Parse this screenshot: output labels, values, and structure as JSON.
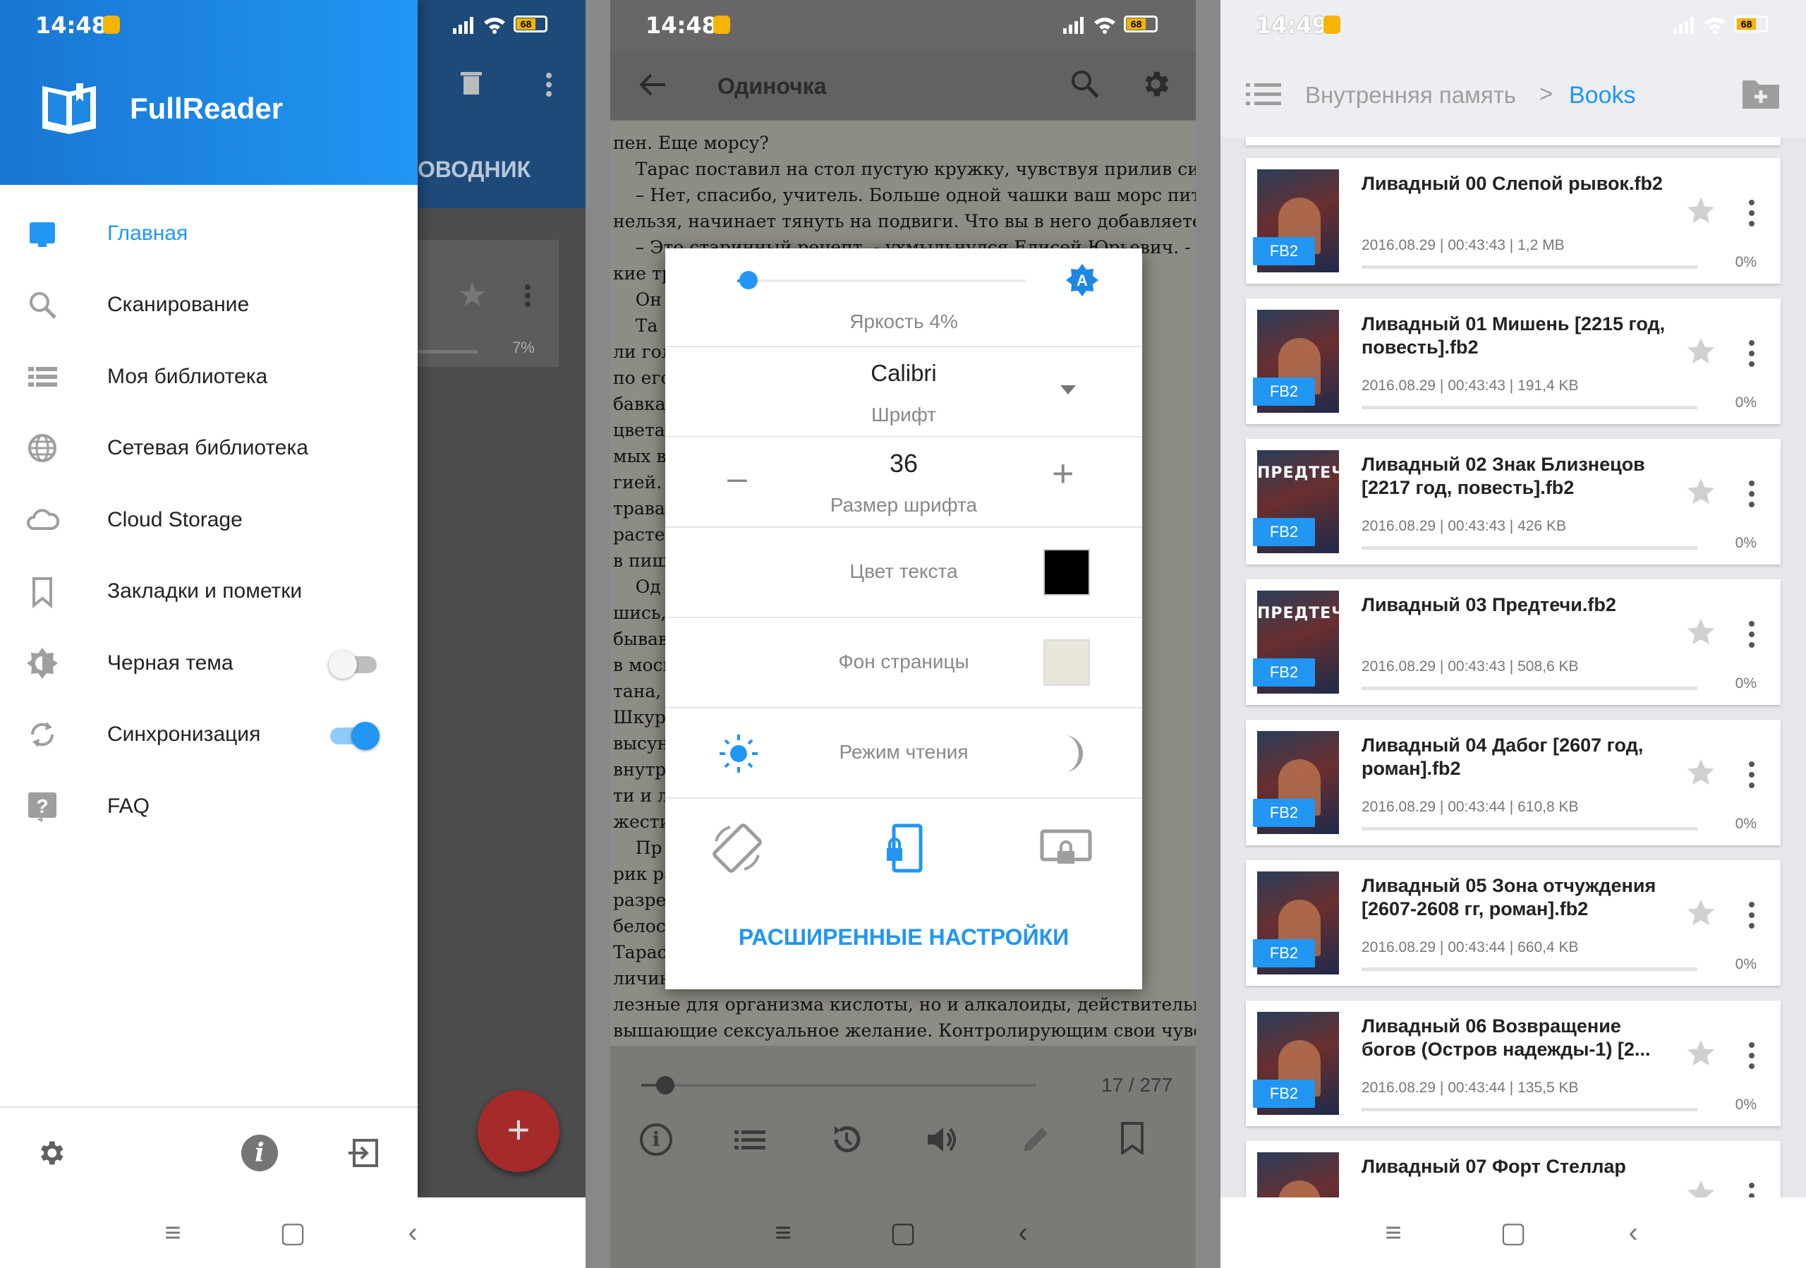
{
  "status_bars": [
    {
      "time": "14:48",
      "battery": "68"
    },
    {
      "time": "14:48",
      "battery": "68"
    },
    {
      "time": "14:49",
      "battery": "68"
    }
  ],
  "drawer": {
    "app_name": "FullReader",
    "items": [
      {
        "label": "Главная",
        "icon": "tablet-icon",
        "active": true
      },
      {
        "label": "Сканирование",
        "icon": "search-icon"
      },
      {
        "label": "Моя библиотека",
        "icon": "list-icon"
      },
      {
        "label": "Сетевая библиотека",
        "icon": "globe-icon"
      },
      {
        "label": "Cloud Storage",
        "icon": "cloud-icon"
      },
      {
        "label": "Закладки и пометки",
        "icon": "bookmark-icon"
      },
      {
        "label": "Черная тема",
        "icon": "theme-icon",
        "toggle": false
      },
      {
        "label": "Синхронизация",
        "icon": "sync-icon",
        "toggle": true
      },
      {
        "label": "FAQ",
        "icon": "help-icon"
      }
    ],
    "behind_tab": "ОВОДНИК",
    "behind_progress": "7%",
    "fab": "+",
    "accent": "#2196f3"
  },
  "reader": {
    "title": "Одиночка",
    "text_lines": [
      "пен. Еще морсу?",
      "    Тарас поставил на стол пустую кружку, чувствуя прилив сил.",
      "    – Нет, спасибо, учитель. Больше одной чашки ваш морс пить",
      "нельзя, начинает тянуть на подвиги. Что вы в него добавляете?",
      "    – Это старинный рецепт, - ухмыльнулся Елисей Юрьевич. - Кое-ка-",
      "кие тр",
      "    Он",
      "    Та                                                           снима-",
      "ли гол                                                         мосу\",",
      "по его                                                         их до-",
      "бавках                                                         равах,",
      "цветах                                                        авляе-",
      "мых в                                                          энер-",
      "гией. С                                                        енных",
      "травах                                                         еских",
      "растен                                                         шиеся",
      "в пищу",
      "    Од                                                         изнав-",
      "шись,                                                          кде не",
      "бывав                                                          ий его",
      "в моск                                                         рамбу-",
      "тана,                                                          лачок.",
      "Шкурк                                                         от-вот",
      "высун                                                          есте с",
      "внутре                                                         мяко-",
      "ти и л                                                         ие све-",
      "жести",
      "    Пр                                                         ый шар-",
      "рик ра                                                         уратно",
      "разрез                                                         лекать",
      "белос                                                           всего",
      "Тарасу                                                         да ве-",
      "личин                                                          и по-",
      "лезные для организма кислоты, но и алкалоиды, действительно по-",
      "вышающие сексуальное желание. Контролирующим свои чувства лю-"
    ],
    "brightness_label": "Яркость 4%",
    "brightness": 0.04,
    "font_name": "Calibri",
    "font_label": "Шрифт",
    "font_size": "36",
    "font_size_label": "Размер шрифта",
    "minus": "–",
    "plus": "+",
    "text_color_label": "Цвет текста",
    "text_color": "#000000",
    "bg_label": "Фон страницы",
    "bg_color": "#e8e5da",
    "mode_label": "Режим чтения",
    "advanced": "РАСШИРЕННЫЕ НАСТРОЙКИ",
    "page_indicator": "17 / 277",
    "progress": 0.06
  },
  "files": {
    "breadcrumb_root": "Внутренняя память",
    "breadcrumb_sep": ">",
    "breadcrumb_current": "Books",
    "books": [
      {
        "title": "Ливадный 00 Слепой рывок.fb2",
        "meta": "2016.08.29 | 00:43:43 | 1,2 MB",
        "format": "FB2",
        "progress": "0%"
      },
      {
        "title": "Ливадный 01 Мишень [2215 год, повесть].fb2",
        "meta": "2016.08.29 | 00:43:43 | 191,4 KB",
        "format": "FB2",
        "progress": "0%"
      },
      {
        "title": "Ливадный 02 Знак Близнецов [2217 год, повесть].fb2",
        "meta": "2016.08.29 | 00:43:43 | 426 KB",
        "format": "FB2",
        "progress": "0%",
        "cover": "ПРЕДТЕЧИ"
      },
      {
        "title": "Ливадный 03 Предтечи.fb2",
        "meta": "2016.08.29 | 00:43:43 | 508,6 KB",
        "format": "FB2",
        "progress": "0%",
        "cover": "ПРЕДТЕЧИ"
      },
      {
        "title": "Ливадный 04 Дабог [2607 год, роман].fb2",
        "meta": "2016.08.29 | 00:43:44 | 610,8 KB",
        "format": "FB2",
        "progress": "0%"
      },
      {
        "title": "Ливадный 05 Зона отчуждения [2607-2608 гг, роман].fb2",
        "meta": "2016.08.29 | 00:43:44 | 660,4 KB",
        "format": "FB2",
        "progress": "0%"
      },
      {
        "title": "Ливадный 06 Возвращение богов (Остров надежды-1) [2...",
        "meta": "2016.08.29 | 00:43:44 | 135,5 KB",
        "format": "FB2",
        "progress": "0%"
      },
      {
        "title": "Ливадный 07 Форт Стеллар",
        "meta": "",
        "format": "",
        "progress": ""
      }
    ]
  }
}
